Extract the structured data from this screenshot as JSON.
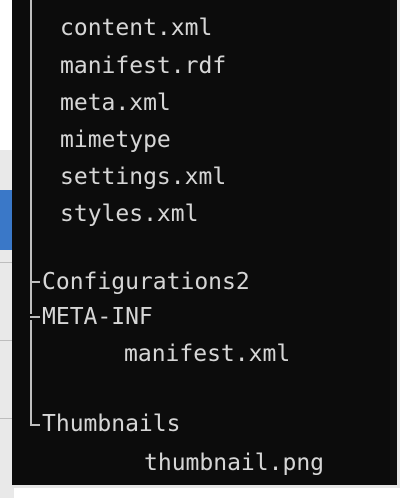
{
  "tree": {
    "root_files": [
      "content.xml",
      "manifest.rdf",
      "meta.xml",
      "mimetype",
      "settings.xml",
      "styles.xml"
    ],
    "folders": [
      {
        "label": "Configurations2",
        "children": []
      },
      {
        "label": "META-INF",
        "children": [
          "manifest.xml"
        ]
      },
      {
        "label": "Thumbnails",
        "children": [
          "thumbnail.png"
        ]
      }
    ]
  },
  "colors": {
    "console_bg": "#0c0c0c",
    "text": "#d6d6d6",
    "tree_lines": "#bfbfbf"
  }
}
